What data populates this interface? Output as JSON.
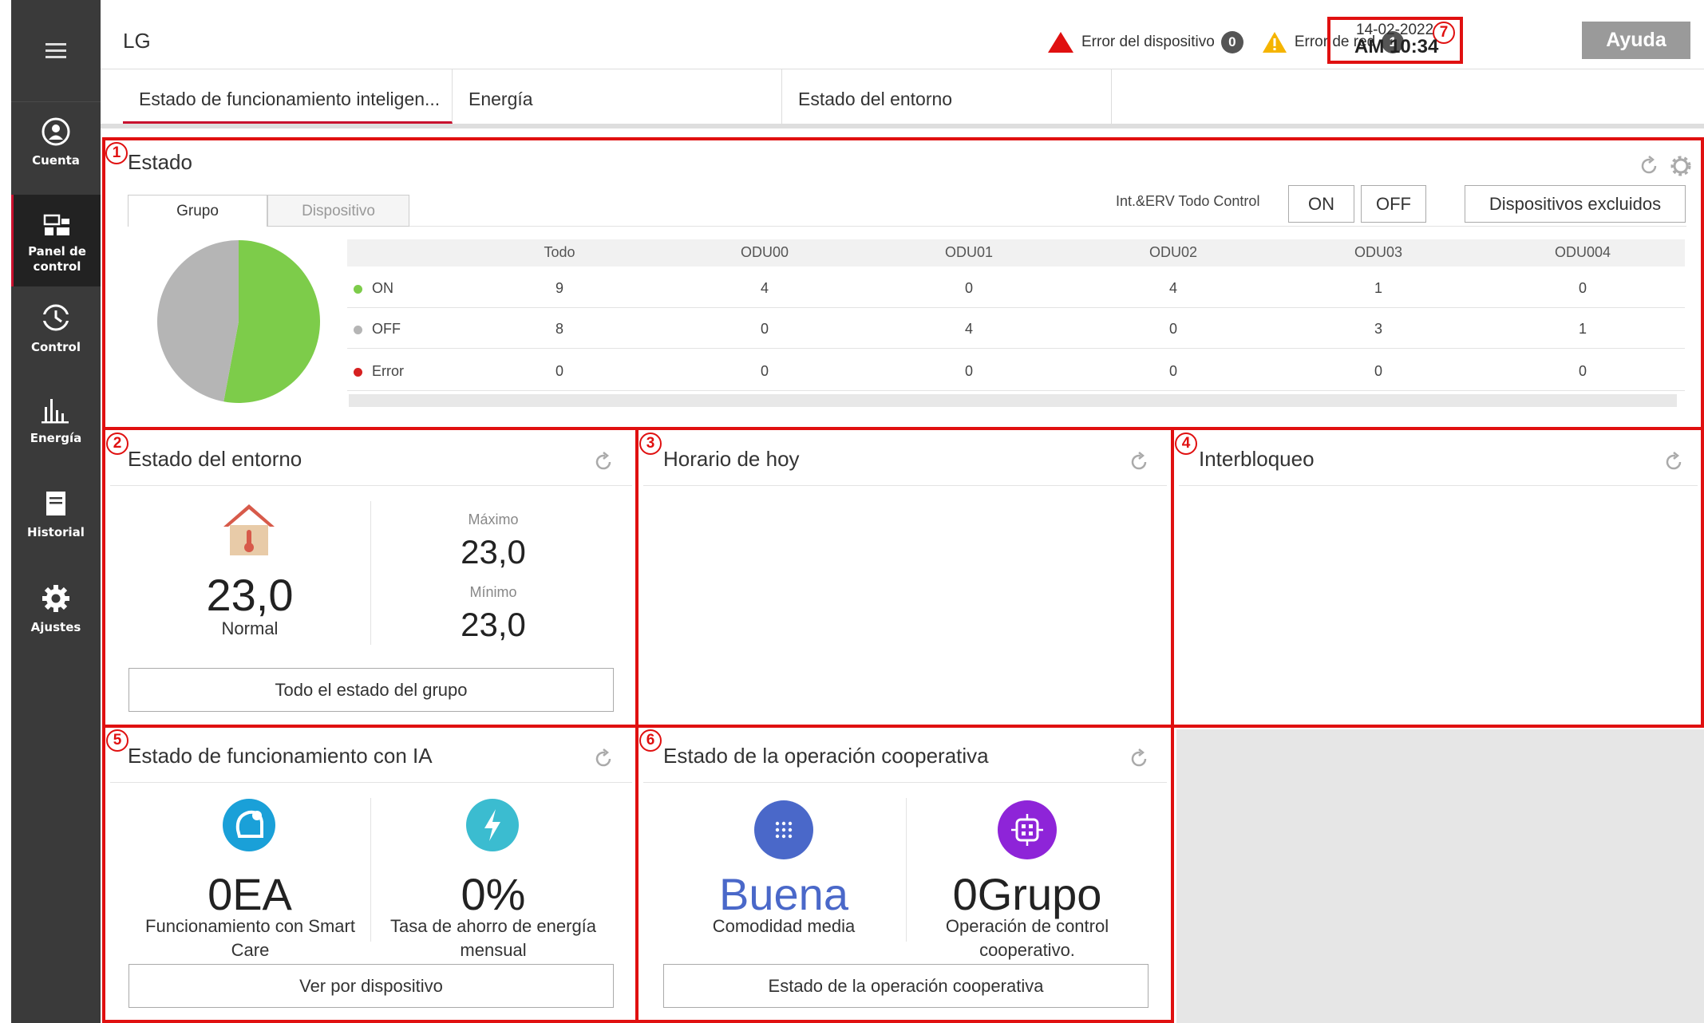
{
  "sidebar": {
    "items": [
      {
        "label": "",
        "icon": "hamburger-icon"
      },
      {
        "label": "Cuenta",
        "icon": "account-icon"
      },
      {
        "label": "Panel de control",
        "icon": "dashboard-icon",
        "active": true
      },
      {
        "label": "Control",
        "icon": "control-icon"
      },
      {
        "label": "Energía",
        "icon": "energy-chart-icon"
      },
      {
        "label": "Historial",
        "icon": "history-icon"
      },
      {
        "label": "Ajustes",
        "icon": "settings-gear-icon"
      }
    ]
  },
  "header": {
    "brand": "LG",
    "device_error_label": "Error del dispositivo",
    "device_error_count": "0",
    "network_error_label": "Error de red",
    "network_error_count": "1",
    "date": "14-02-2022",
    "time": "AM 10:34",
    "help_label": "Ayuda"
  },
  "tabs": [
    "Estado de funcionamiento inteligen...",
    "Energía",
    "Estado del entorno"
  ],
  "panels": {
    "status": {
      "num": "1",
      "title": "Estado",
      "subtabs": [
        "Grupo",
        "Dispositivo"
      ],
      "control_label": "Int.&ERV Todo Control",
      "on_label": "ON",
      "off_label": "OFF",
      "excluded_label": "Dispositivos excluidos",
      "columns": [
        "Todo",
        "ODU00",
        "ODU01",
        "ODU02",
        "ODU03",
        "ODU004"
      ],
      "rows": [
        {
          "label": "ON",
          "values": [
            "9",
            "4",
            "0",
            "4",
            "1",
            "0"
          ]
        },
        {
          "label": "OFF",
          "values": [
            "8",
            "0",
            "4",
            "0",
            "3",
            "1"
          ]
        },
        {
          "label": "Error",
          "values": [
            "0",
            "0",
            "0",
            "0",
            "0",
            "0"
          ]
        }
      ],
      "pie": {
        "on": 9,
        "off": 8,
        "error": 0
      }
    },
    "environment": {
      "num": "2",
      "title": "Estado del entorno",
      "current_value": "23,0",
      "current_state": "Normal",
      "max_label": "Máximo",
      "max_value": "23,0",
      "min_label": "Mínimo",
      "min_value": "23,0",
      "button_label": "Todo el estado del grupo"
    },
    "schedule": {
      "num": "3",
      "title": "Horario de hoy"
    },
    "interlock": {
      "num": "4",
      "title": "Interbloqueo"
    },
    "ai": {
      "num": "5",
      "title": "Estado de funcionamiento con IA",
      "left_value": "0EA",
      "left_label": "Funcionamiento con Smart Care",
      "right_value": "0%",
      "right_label": "Tasa de ahorro de energía mensual",
      "button_label": "Ver por dispositivo"
    },
    "coop": {
      "num": "6",
      "title": "Estado de la operación cooperativa",
      "left_value": "Buena",
      "left_label": "Comodidad media",
      "right_value": "0Grupo",
      "right_label": "Operación de control cooperativo.",
      "button_label": "Estado de la operación cooperativa"
    },
    "datetime": {
      "num": "7"
    }
  },
  "colors": {
    "annotation_red": "#e01010",
    "on_green": "#7dcc4a",
    "off_gray": "#b5b5b5",
    "error_red": "#d62020",
    "buena_blue": "#4a68c9",
    "sidebar": "#3a3a3a"
  }
}
